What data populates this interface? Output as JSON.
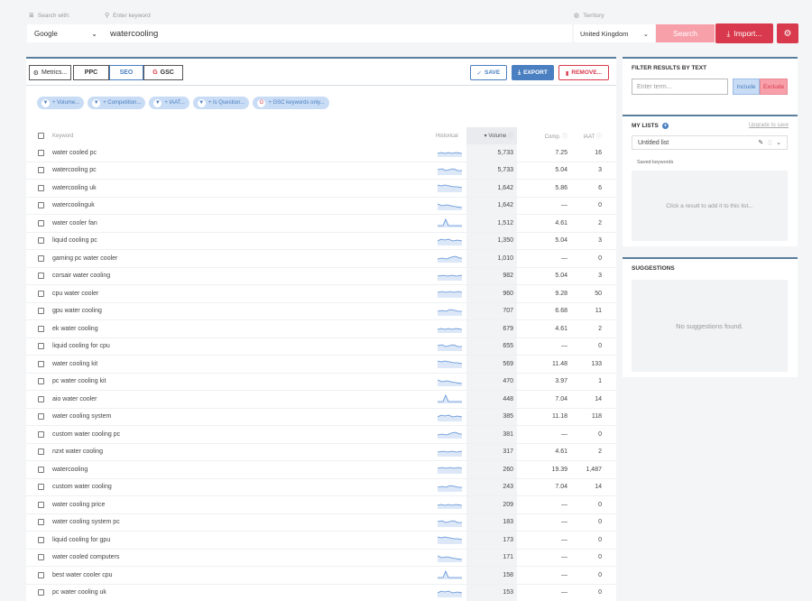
{
  "search": {
    "search_with_label": "Search with:",
    "keyword_label": "Enter keyword",
    "territory_label": "Territory",
    "engine": "Google",
    "keyword": "watercooling",
    "territory": "United Kingdom",
    "search_button": "Search",
    "import_button": "Import...",
    "icons": {
      "list": "list-icon",
      "search": "search-icon",
      "globe": "globe-icon",
      "gear": "gear-icon",
      "import": "import-icon"
    }
  },
  "toolbar": {
    "metrics": "Metrics...",
    "ppc": "PPC",
    "seo": "SEO",
    "gsc": "GSC",
    "save": "SAVE",
    "export": "EXPORT",
    "remove": "REMOVE..."
  },
  "filters": [
    "+ Volume...",
    "+ Competition...",
    "+ IAAT...",
    "+ Is Question...",
    "+ GSC keywords only..."
  ],
  "table": {
    "headers": {
      "keyword": "Keyword",
      "historical": "Historical",
      "volume": "Volume",
      "comp": "Comp.",
      "iaat": "IAAT"
    },
    "rows": [
      {
        "keyword": "water cooled pc",
        "volume": "5,733",
        "comp": "7.25",
        "iaat": "16"
      },
      {
        "keyword": "watercooling pc",
        "volume": "5,733",
        "comp": "5.04",
        "iaat": "3"
      },
      {
        "keyword": "watercooling uk",
        "volume": "1,642",
        "comp": "5.86",
        "iaat": "6"
      },
      {
        "keyword": "watercoolinguk",
        "volume": "1,642",
        "comp": "—",
        "iaat": "0"
      },
      {
        "keyword": "water cooler fan",
        "volume": "1,512",
        "comp": "4.61",
        "iaat": "2"
      },
      {
        "keyword": "liquid cooling pc",
        "volume": "1,350",
        "comp": "5.04",
        "iaat": "3"
      },
      {
        "keyword": "gaming pc water cooler",
        "volume": "1,010",
        "comp": "—",
        "iaat": "0"
      },
      {
        "keyword": "corsair water cooling",
        "volume": "982",
        "comp": "5.04",
        "iaat": "3"
      },
      {
        "keyword": "cpu water cooler",
        "volume": "960",
        "comp": "9.28",
        "iaat": "50"
      },
      {
        "keyword": "gpu water cooling",
        "volume": "707",
        "comp": "6.68",
        "iaat": "11"
      },
      {
        "keyword": "ek water cooling",
        "volume": "679",
        "comp": "4.61",
        "iaat": "2"
      },
      {
        "keyword": "liquid cooling for cpu",
        "volume": "655",
        "comp": "—",
        "iaat": "0"
      },
      {
        "keyword": "water cooling kit",
        "volume": "569",
        "comp": "11.48",
        "iaat": "133"
      },
      {
        "keyword": "pc water cooling kit",
        "volume": "470",
        "comp": "3.97",
        "iaat": "1"
      },
      {
        "keyword": "aio water cooler",
        "volume": "448",
        "comp": "7.04",
        "iaat": "14"
      },
      {
        "keyword": "water cooling system",
        "volume": "385",
        "comp": "11.18",
        "iaat": "118"
      },
      {
        "keyword": "custom water cooling pc",
        "volume": "381",
        "comp": "—",
        "iaat": "0"
      },
      {
        "keyword": "nzxt water cooling",
        "volume": "317",
        "comp": "4.61",
        "iaat": "2"
      },
      {
        "keyword": "watercooling",
        "volume": "260",
        "comp": "19.39",
        "iaat": "1,487"
      },
      {
        "keyword": "custom water cooling",
        "volume": "243",
        "comp": "7.04",
        "iaat": "14"
      },
      {
        "keyword": "water cooling price",
        "volume": "209",
        "comp": "—",
        "iaat": "0"
      },
      {
        "keyword": "water cooling system pc",
        "volume": "183",
        "comp": "—",
        "iaat": "0"
      },
      {
        "keyword": "liquid cooling for gpu",
        "volume": "173",
        "comp": "—",
        "iaat": "0"
      },
      {
        "keyword": "water cooled computers",
        "volume": "171",
        "comp": "—",
        "iaat": "0"
      },
      {
        "keyword": "best water cooler cpu",
        "volume": "158",
        "comp": "—",
        "iaat": "0"
      },
      {
        "keyword": "pc water cooling uk",
        "volume": "153",
        "comp": "—",
        "iaat": "0"
      }
    ]
  },
  "filter_panel": {
    "title": "FILTER RESULTS BY TEXT",
    "placeholder": "Enter term...",
    "include": "Include",
    "exclude": "Exclude"
  },
  "lists_panel": {
    "title": "MY LISTS",
    "upgrade": "Upgrade to save",
    "selected_list": "Untitled list",
    "saved_label": "Saved keywords",
    "empty_text": "Click a result to add it to this list..."
  },
  "suggestions_panel": {
    "title": "SUGGESTIONS",
    "empty_text": "No suggestions found."
  },
  "colors": {
    "accent_red": "#d9394c",
    "accent_blue": "#4a7fc1",
    "pink": "#f7a0aa",
    "chip_blue": "#c9dcf5",
    "spark": "#5b8fd6"
  }
}
